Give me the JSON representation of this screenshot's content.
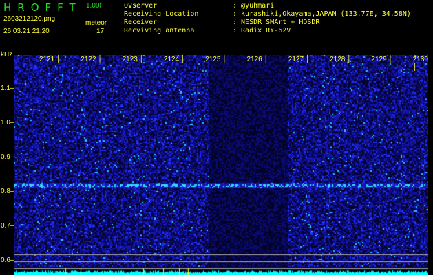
{
  "header": {
    "logo": "HROFFT",
    "version": "1.00f",
    "filename": "2603212120.png",
    "datetime": "26.03.21 21:20",
    "mode_label": "meteor",
    "count": "17"
  },
  "info": [
    {
      "key": "Ovserver",
      "value": ": @yuhmari"
    },
    {
      "key": "Receiving Location",
      "value": ": kurashiki,Okayama,JAPAN (133.77E, 34.58N)"
    },
    {
      "key": "Receiver",
      "value": ": NESDR SMArt + HDSDR"
    },
    {
      "key": "Recviving antenna",
      "value": ": Radix RY-62V"
    }
  ],
  "colors": {
    "text": "#ffff33",
    "logo": "#22dd22",
    "spectrum": "#00ffff",
    "background": "#000000"
  },
  "chart_data": {
    "type": "heatmap",
    "title": "HROFFT waterfall",
    "ylabel": "kHz",
    "x_ticks": [
      "2121",
      "2122",
      "2123",
      "2124",
      "2125",
      "2126",
      "2127",
      "2128",
      "2129",
      "2130"
    ],
    "y_ticks": [
      "1.1",
      "1.0",
      "0.9",
      "0.8",
      "0.7",
      "0.6"
    ],
    "ylim": [
      0.58,
      1.2
    ],
    "carrier_khz": 0.82,
    "dark_band_minutes": [
      2124.9,
      2126.8
    ]
  }
}
